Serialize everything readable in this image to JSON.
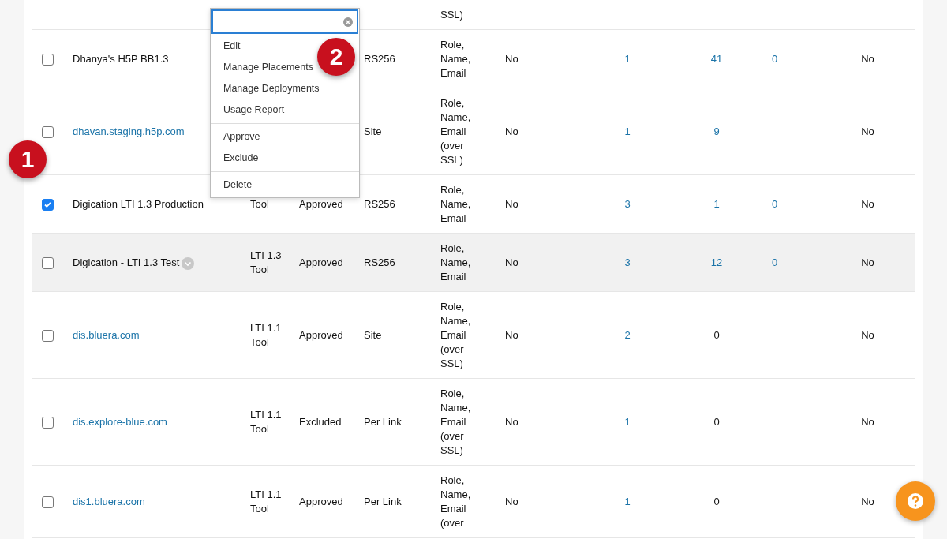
{
  "table": {
    "rows": [
      {
        "checked": null,
        "highlighted": false,
        "cells": {
          "data": {
            "text": "SSL)",
            "link": false
          }
        }
      },
      {
        "checked": false,
        "highlighted": false,
        "cells": {
          "name": {
            "text": "Dhanya's H5P BB1.3",
            "link": false
          },
          "key": {
            "text": "RS256",
            "link": false
          },
          "data": {
            "text": "Role, Name, Email",
            "link": false
          },
          "column_7": {
            "text": "No",
            "link": false
          },
          "column_8": {
            "text": "1",
            "link": true
          },
          "column_9": {
            "text": "41",
            "link": true
          },
          "column_10": {
            "text": "0",
            "link": true
          },
          "column_11": {
            "text": "No",
            "link": false
          }
        }
      },
      {
        "checked": false,
        "highlighted": false,
        "cells": {
          "name": {
            "text": "dhavan.staging.h5p.com",
            "link": true
          },
          "key": {
            "text": "Site",
            "link": false
          },
          "data": {
            "text": "Role, Name, Email (over SSL)",
            "link": false
          },
          "column_7": {
            "text": "No",
            "link": false
          },
          "column_8": {
            "text": "1",
            "link": true
          },
          "column_9": {
            "text": "9",
            "link": true
          },
          "column_11": {
            "text": "No",
            "link": false
          }
        }
      },
      {
        "checked": true,
        "highlighted": false,
        "cells": {
          "name": {
            "text": "Digication LTI 1.3 Production",
            "link": false
          },
          "type": {
            "text": "Tool",
            "link": false
          },
          "status": {
            "text": "Approved",
            "link": false
          },
          "key": {
            "text": "RS256",
            "link": false
          },
          "data": {
            "text": "Role, Name, Email",
            "link": false
          },
          "column_7": {
            "text": "No",
            "link": false
          },
          "column_8": {
            "text": "3",
            "link": true
          },
          "column_9": {
            "text": "1",
            "link": true
          },
          "column_10": {
            "text": "0",
            "link": true
          },
          "column_11": {
            "text": "No",
            "link": false
          }
        }
      },
      {
        "checked": false,
        "highlighted": true,
        "menu_button": true,
        "cells": {
          "name": {
            "text": "Digication - LTI 1.3 Test",
            "link": false
          },
          "type": {
            "text": "LTI 1.3 Tool",
            "link": false
          },
          "status": {
            "text": "Approved",
            "link": false
          },
          "key": {
            "text": "RS256",
            "link": false
          },
          "data": {
            "text": "Role, Name, Email",
            "link": false
          },
          "column_7": {
            "text": "No",
            "link": false
          },
          "column_8": {
            "text": "3",
            "link": true
          },
          "column_9": {
            "text": "12",
            "link": true
          },
          "column_10": {
            "text": "0",
            "link": true
          },
          "column_11": {
            "text": "No",
            "link": false
          }
        }
      },
      {
        "checked": false,
        "highlighted": false,
        "cells": {
          "name": {
            "text": "dis.bluera.com",
            "link": true
          },
          "type": {
            "text": "LTI 1.1 Tool",
            "link": false
          },
          "status": {
            "text": "Approved",
            "link": false
          },
          "key": {
            "text": "Site",
            "link": false
          },
          "data": {
            "text": "Role, Name, Email (over SSL)",
            "link": false
          },
          "column_7": {
            "text": "No",
            "link": false
          },
          "column_8": {
            "text": "2",
            "link": true
          },
          "column_9": {
            "text": "0",
            "link": false
          },
          "column_11": {
            "text": "No",
            "link": false
          }
        }
      },
      {
        "checked": false,
        "highlighted": false,
        "cells": {
          "name": {
            "text": "dis.explore-blue.com",
            "link": true
          },
          "type": {
            "text": "LTI 1.1 Tool",
            "link": false
          },
          "status": {
            "text": "Excluded",
            "link": false
          },
          "key": {
            "text": "Per Link",
            "link": false
          },
          "data": {
            "text": "Role, Name, Email (over SSL)",
            "link": false
          },
          "column_7": {
            "text": "No",
            "link": false
          },
          "column_8": {
            "text": "1",
            "link": true
          },
          "column_9": {
            "text": "0",
            "link": false
          },
          "column_11": {
            "text": "No",
            "link": false
          }
        }
      },
      {
        "checked": false,
        "highlighted": false,
        "cells": {
          "name": {
            "text": "dis1.bluera.com",
            "link": true
          },
          "type": {
            "text": "LTI 1.1 Tool",
            "link": false
          },
          "status": {
            "text": "Approved",
            "link": false
          },
          "key": {
            "text": "Per Link",
            "link": false
          },
          "data": {
            "text": "Role, Name, Email (over",
            "link": false
          },
          "column_7": {
            "text": "No",
            "link": false
          },
          "column_8": {
            "text": "1",
            "link": true
          },
          "column_9": {
            "text": "0",
            "link": false
          },
          "column_11": {
            "text": "No",
            "link": false
          }
        }
      }
    ]
  },
  "context_menu": {
    "groups": [
      [
        "Edit",
        "Manage Placements",
        "Manage Deployments",
        "Usage Report"
      ],
      [
        "Approve",
        "Exclude"
      ],
      [
        "Delete"
      ]
    ]
  },
  "callouts": [
    "1",
    "2"
  ]
}
